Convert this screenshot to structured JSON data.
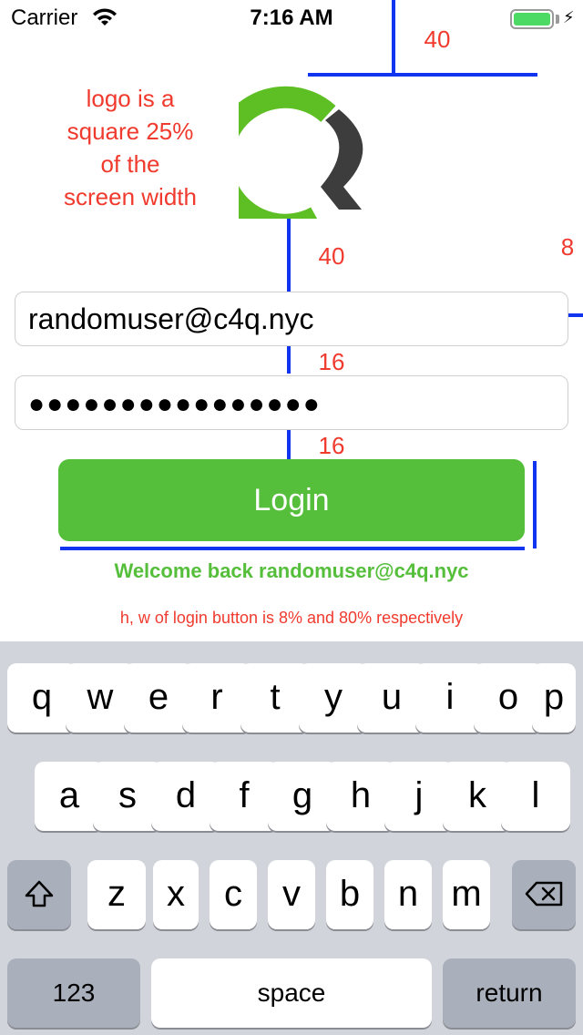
{
  "status_bar": {
    "carrier": "Carrier",
    "time": "7:16 AM"
  },
  "annotations": {
    "logo_note": "logo is a square 25% of the screen width",
    "spacing_top": "40",
    "spacing_logo_email": "40",
    "spacing_email_password": "16",
    "spacing_password_button": "16",
    "side_margin": "8",
    "button_note": "h, w of login button is 8% and 80% respectively"
  },
  "form": {
    "email_value": "randomuser@c4q.nyc",
    "password_masked": "●●●●●●●●●●●●●●●●",
    "login_label": "Login",
    "welcome_message": "Welcome back randomuser@c4q.nyc"
  },
  "colors": {
    "accent_green": "#55bf3b",
    "guide_blue": "#1034f0",
    "annotation_red": "#f03a2e",
    "logo_dark": "#3d3d3d"
  },
  "keyboard": {
    "row1": [
      "q",
      "w",
      "e",
      "r",
      "t",
      "y",
      "u",
      "i",
      "o",
      "p"
    ],
    "row2": [
      "a",
      "s",
      "d",
      "f",
      "g",
      "h",
      "j",
      "k",
      "l"
    ],
    "row3": [
      "z",
      "x",
      "c",
      "v",
      "b",
      "n",
      "m"
    ],
    "shift_icon": "shift-icon",
    "delete_icon": "backspace-icon",
    "numbers_label": "123",
    "space_label": "space",
    "return_label": "return"
  }
}
